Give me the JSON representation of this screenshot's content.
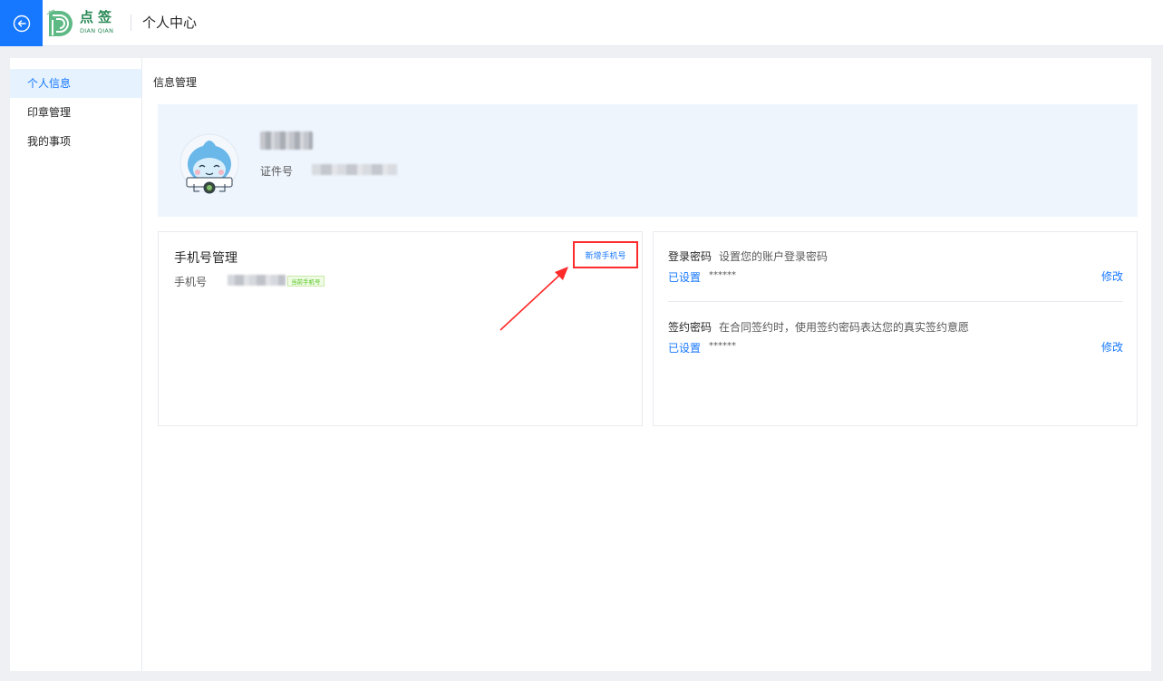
{
  "header": {
    "logo_cn": "点签",
    "logo_en": "DIAN QIAN",
    "page_title": "个人中心",
    "accent_color": "#1677ff"
  },
  "sidebar": {
    "items": [
      {
        "label": "个人信息",
        "active": true
      },
      {
        "label": "印章管理",
        "active": false
      },
      {
        "label": "我的事项",
        "active": false
      }
    ]
  },
  "main": {
    "section_title": "信息管理",
    "profile": {
      "id_label": "证件号"
    },
    "phone_card": {
      "title": "手机号管理",
      "add_button": "新增手机号",
      "phone_label": "手机号",
      "current_badge": "当前手机号"
    },
    "password_card": {
      "login": {
        "name": "登录密码",
        "description": "设置您的账户登录密码",
        "status": "已设置",
        "mask": "******",
        "edit": "修改"
      },
      "sign": {
        "name": "签约密码",
        "description": "在合同签约时，使用签约密码表达您的真实签约意愿",
        "status": "已设置",
        "mask": "******",
        "edit": "修改"
      }
    }
  }
}
